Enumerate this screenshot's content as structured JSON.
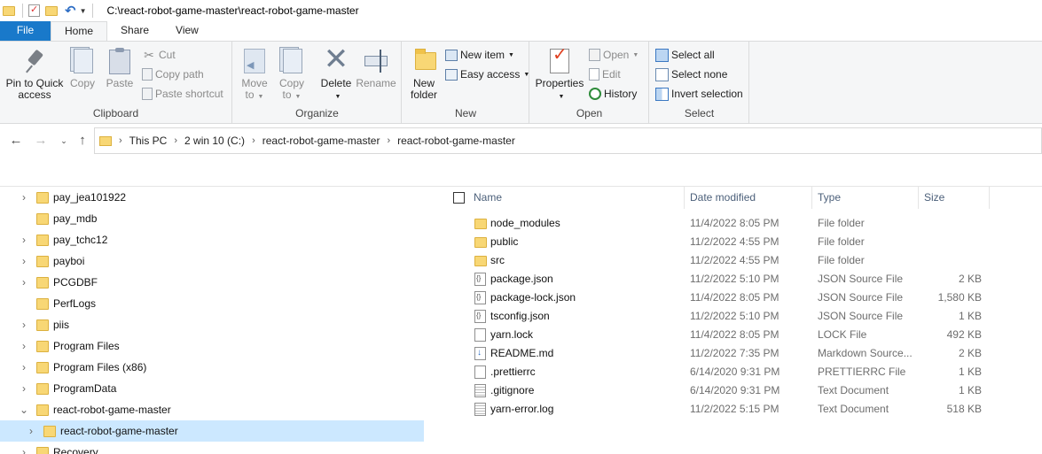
{
  "window": {
    "title_path": "C:\\react-robot-game-master\\react-robot-game-master"
  },
  "tabs": [
    "File",
    "Home",
    "Share",
    "View"
  ],
  "ribbon": {
    "clipboard": {
      "label": "Clipboard",
      "pin": "Pin to Quick access",
      "pin_line1": "Pin to Quick",
      "pin_line2": "access",
      "copy": "Copy",
      "paste": "Paste",
      "cut": "Cut",
      "copy_path": "Copy path",
      "paste_shortcut": "Paste shortcut"
    },
    "organize": {
      "label": "Organize",
      "move_to_1": "Move",
      "move_to_2": "to",
      "copy_to_1": "Copy",
      "copy_to_2": "to",
      "delete": "Delete",
      "rename": "Rename"
    },
    "new": {
      "label": "New",
      "new_folder_1": "New",
      "new_folder_2": "folder",
      "new_item": "New item",
      "easy_access": "Easy access"
    },
    "open": {
      "label": "Open",
      "properties": "Properties",
      "open": "Open",
      "edit": "Edit",
      "history": "History"
    },
    "select": {
      "label": "Select",
      "select_all": "Select all",
      "select_none": "Select none",
      "invert_selection": "Invert selection"
    }
  },
  "address": {
    "crumbs": [
      "This PC",
      "2 win 10  (C:)",
      "react-robot-game-master",
      "react-robot-game-master"
    ]
  },
  "nav_tree": [
    {
      "label": "pay_jea101922",
      "expandable": true
    },
    {
      "label": "pay_mdb",
      "expandable": false
    },
    {
      "label": "pay_tchc12",
      "expandable": true
    },
    {
      "label": "payboi",
      "expandable": true
    },
    {
      "label": "PCGDBF",
      "expandable": true
    },
    {
      "label": "PerfLogs",
      "expandable": false
    },
    {
      "label": "piis",
      "expandable": true
    },
    {
      "label": "Program Files",
      "expandable": true
    },
    {
      "label": "Program Files (x86)",
      "expandable": true
    },
    {
      "label": "ProgramData",
      "expandable": true
    },
    {
      "label": "react-robot-game-master",
      "expandable": true,
      "expanded": true
    },
    {
      "label": "react-robot-game-master",
      "expandable": true,
      "selected": true,
      "child": true
    },
    {
      "label": "Recovery",
      "expandable": true
    }
  ],
  "columns": {
    "name": "Name",
    "date": "Date modified",
    "type": "Type",
    "size": "Size"
  },
  "files": [
    {
      "name": "node_modules",
      "date": "11/4/2022 8:05 PM",
      "type": "File folder",
      "size": "",
      "icon": "folder"
    },
    {
      "name": "public",
      "date": "11/2/2022 4:55 PM",
      "type": "File folder",
      "size": "",
      "icon": "folder"
    },
    {
      "name": "src",
      "date": "11/2/2022 4:55 PM",
      "type": "File folder",
      "size": "",
      "icon": "folder"
    },
    {
      "name": "package.json",
      "date": "11/2/2022 5:10 PM",
      "type": "JSON Source File",
      "size": "2 KB",
      "icon": "json"
    },
    {
      "name": "package-lock.json",
      "date": "11/4/2022 8:05 PM",
      "type": "JSON Source File",
      "size": "1,580 KB",
      "icon": "json"
    },
    {
      "name": "tsconfig.json",
      "date": "11/2/2022 5:10 PM",
      "type": "JSON Source File",
      "size": "1 KB",
      "icon": "json"
    },
    {
      "name": "yarn.lock",
      "date": "11/4/2022 8:05 PM",
      "type": "LOCK File",
      "size": "492 KB",
      "icon": "doc"
    },
    {
      "name": "README.md",
      "date": "11/2/2022 7:35 PM",
      "type": "Markdown Source...",
      "size": "2 KB",
      "icon": "md"
    },
    {
      "name": ".prettierrc",
      "date": "6/14/2020 9:31 PM",
      "type": "PRETTIERRC File",
      "size": "1 KB",
      "icon": "doc"
    },
    {
      "name": ".gitignore",
      "date": "6/14/2020 9:31 PM",
      "type": "Text Document",
      "size": "1 KB",
      "icon": "txt"
    },
    {
      "name": "yarn-error.log",
      "date": "11/2/2022 5:15 PM",
      "type": "Text Document",
      "size": "518 KB",
      "icon": "txt"
    }
  ],
  "colors": {
    "file_tab": "#1979ca",
    "selection": "#cce8ff",
    "folder": "#f8d775"
  }
}
